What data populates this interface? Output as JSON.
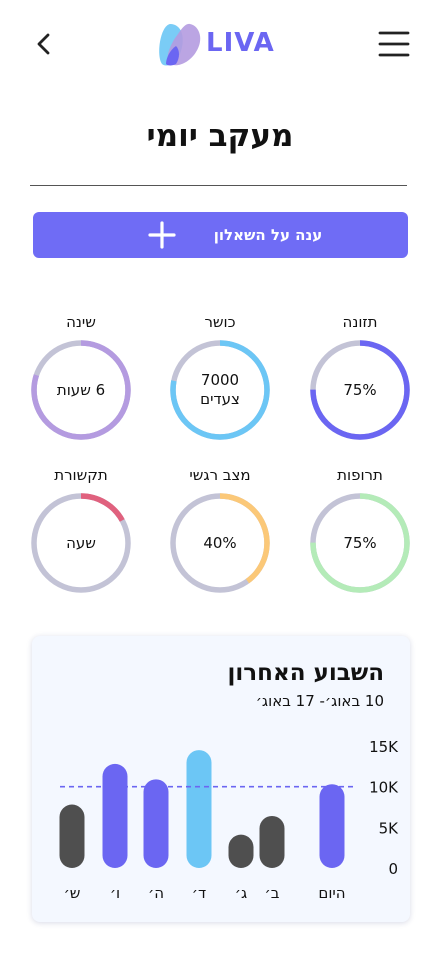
{
  "header": {
    "logo_text": "LIVA"
  },
  "page_title": "מעקב יומי",
  "cta": {
    "label": "ענה על השאלון"
  },
  "metrics": [
    {
      "label": "תזונה",
      "value": "75%",
      "progress": 0.75,
      "color": "#6b66f2"
    },
    {
      "label": "כושר",
      "value_line1": "7000",
      "value_line2": "צעדים",
      "progress": 0.78,
      "color": "#6cc6f5"
    },
    {
      "label": "שינה",
      "value": "6 שעות",
      "progress": 0.8,
      "color": "#b49be0"
    },
    {
      "label": "תרופות",
      "value": "75%",
      "progress": 0.75,
      "color": "#b4ebb8"
    },
    {
      "label": "מצב רגשי",
      "value": "40%",
      "progress": 0.4,
      "color": "#fbc878"
    },
    {
      "label": "תקשורת",
      "value": "שעה",
      "progress": 0.17,
      "color": "#e0617e"
    }
  ],
  "ring_track_color": "#c3c3d6",
  "weekly_card": {
    "title": "השבוע האחרון",
    "subtitle": "10 באוג׳- 17 באוג׳"
  },
  "chart_data": {
    "type": "bar",
    "title": "השבוע האחרון",
    "subtitle": "10 באוג׳- 17 באוג׳",
    "categories": [
      "היום",
      "ב׳",
      "ג׳",
      "ד׳",
      "ה׳",
      "ו׳",
      "ש׳"
    ],
    "values": [
      10300,
      6400,
      4100,
      14500,
      10900,
      12800,
      7800
    ],
    "colors": [
      "#6b66f2",
      "#4f4f4f",
      "#4f4f4f",
      "#6cc6f5",
      "#6b66f2",
      "#6b66f2",
      "#4f4f4f"
    ],
    "yticks": [
      {
        "value": 0,
        "label": "0"
      },
      {
        "value": 5000,
        "label": "5K"
      },
      {
        "value": 10000,
        "label": "10K"
      },
      {
        "value": 15000,
        "label": "15K"
      }
    ],
    "goal_line": 10000,
    "ylim": [
      0,
      15000
    ],
    "y_axis_side": "right",
    "grid": false
  }
}
